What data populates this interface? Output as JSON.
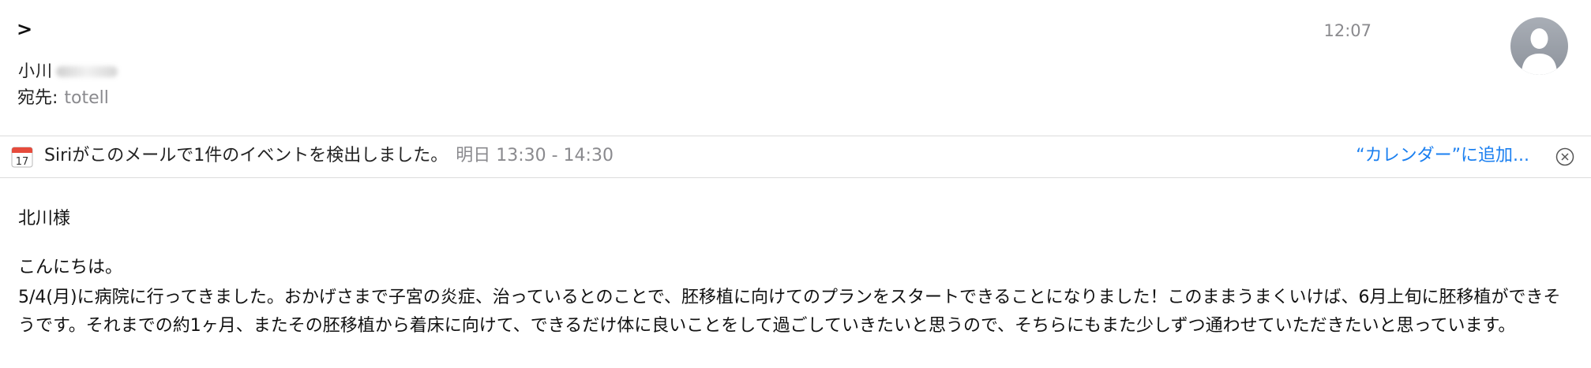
{
  "header": {
    "back_glyph": ">",
    "sender_visible": "小川",
    "to_label": "宛先:",
    "to_value": "totell",
    "time": "12:07"
  },
  "siri_banner": {
    "message": "Siriがこのメールで1件のイベントを検出しました。",
    "event_time": "明日 13:30 - 14:30",
    "add_to_calendar": "“カレンダー”に追加...",
    "calendar_day": "17"
  },
  "email_body": {
    "salutation": "北川様",
    "greeting": "こんにちは。",
    "paragraph": "5/4(月)に病院に行ってきました。おかげさまで子宮の炎症、治っているとのことで、胚移植に向けてのプランをスタートできることになりました！このままうまくいけば、6月上旬に胚移植ができそうです。それまでの約1ヶ月、またその胚移植から着床に向けて、できるだけ体に良いことをして過ごしていきたいと思うので、そちらにもまた少しずつ通わせていただきたいと思っています。"
  },
  "colors": {
    "link_blue": "#1a7ff0",
    "secondary_gray": "#8a8a8e",
    "divider": "#dcdcdc",
    "calendar_red": "#e64b3c"
  }
}
